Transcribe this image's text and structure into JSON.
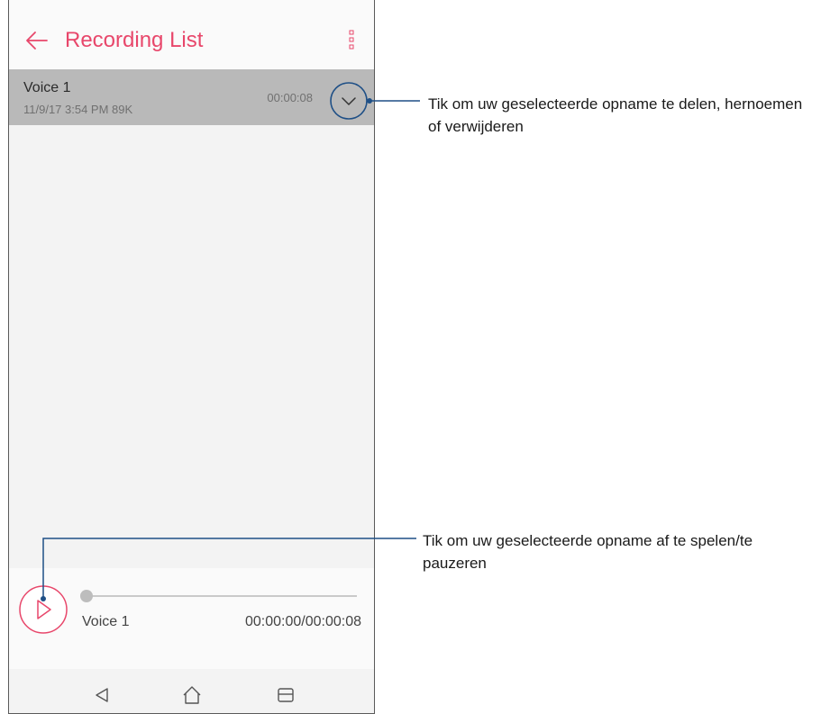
{
  "header": {
    "title": "Recording List",
    "back_icon": "arrow-left-icon",
    "menu_icon": "more-vertical-icon"
  },
  "recordings": [
    {
      "name": "Voice 1",
      "meta": "11/9/17 3:54 PM  89K",
      "duration": "00:00:08",
      "selected": true
    }
  ],
  "player": {
    "name": "Voice 1",
    "time": "00:00:00/00:00:08",
    "progress": 0,
    "play_icon": "play-icon"
  },
  "navbar": {
    "back_icon": "nav-back-icon",
    "home_icon": "nav-home-icon",
    "recents_icon": "nav-recents-icon"
  },
  "annotations": {
    "expand": "Tik om uw geselecteerde opname te delen, hernoemen of verwijderen",
    "play": "Tik om uw geselecteerde opname af te spelen/te pauzeren"
  },
  "colors": {
    "accent": "#e8476b",
    "callout_line": "#1e4f86",
    "selected_row": "#b9b9b9"
  }
}
